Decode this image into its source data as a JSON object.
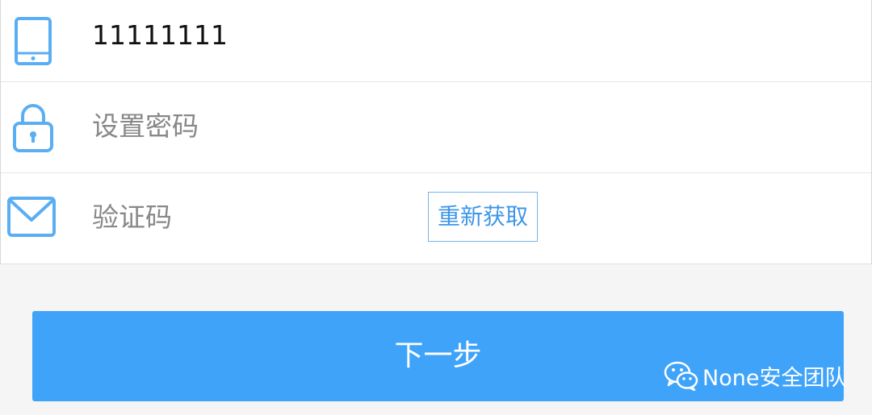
{
  "colors": {
    "accent": "#3fa3fa",
    "icon_blue": "#5aaef3",
    "placeholder": "#888888"
  },
  "form": {
    "phone": {
      "icon": "phone-icon",
      "value": "11111111"
    },
    "password": {
      "icon": "lock-icon",
      "placeholder": "设置密码"
    },
    "code": {
      "icon": "mail-icon",
      "placeholder": "验证码",
      "resend_label": "重新获取"
    }
  },
  "next_button": {
    "label": "下一步"
  },
  "watermark": {
    "icon": "wechat-icon",
    "text": "None安全团队"
  }
}
